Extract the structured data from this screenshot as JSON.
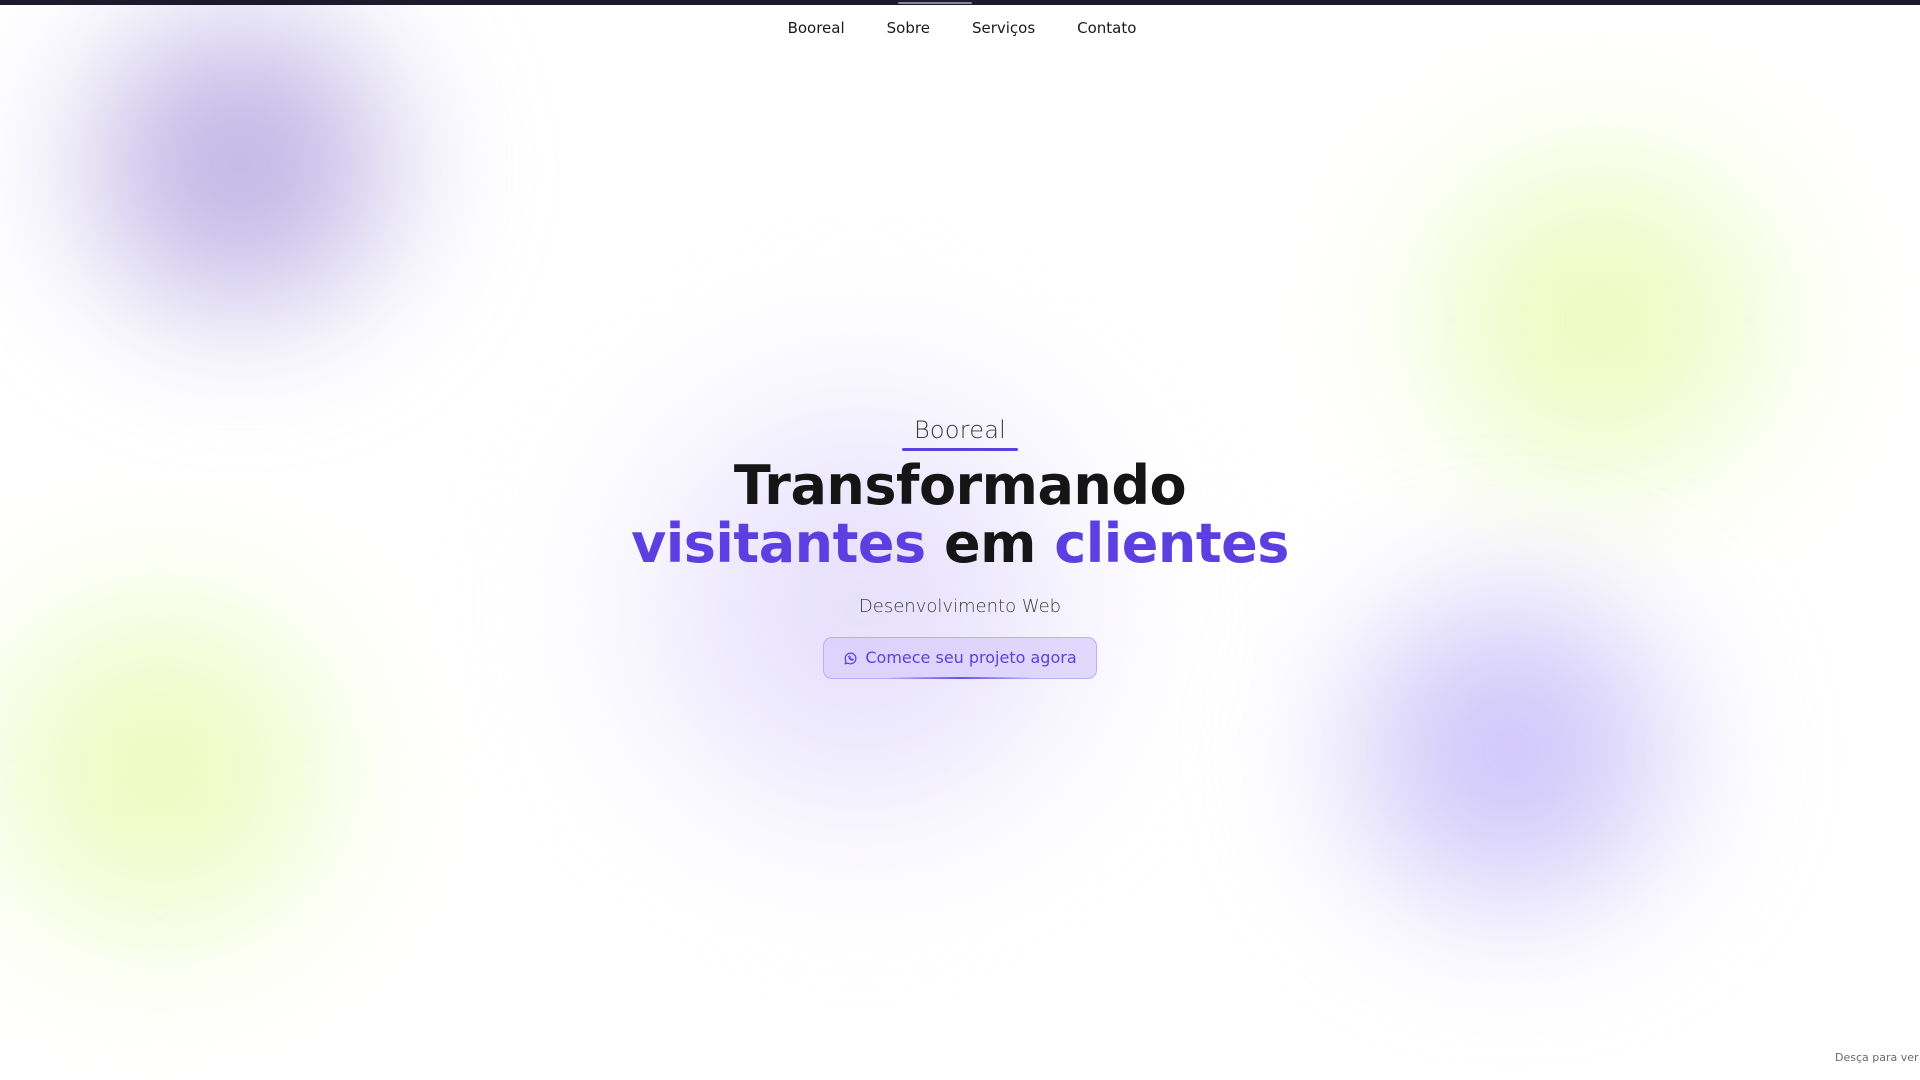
{
  "nav": {
    "items": [
      {
        "label": "Booreal"
      },
      {
        "label": "Sobre"
      },
      {
        "label": "Serviços"
      },
      {
        "label": "Contato"
      }
    ]
  },
  "hero": {
    "brand": "Booreal",
    "headline_line1": "Transformando",
    "headline_word1": "visitantes",
    "headline_word2": "em",
    "headline_word3": "clientes",
    "subtitle": "Desenvolvimento Web",
    "cta_label": "Comece seu projeto agora",
    "cta_icon": "whatsapp-icon"
  },
  "scroll_hint": "Desça para ver m",
  "colors": {
    "accent": "#5b3fe0",
    "text_dark": "#151515",
    "top_bar": "#1d1a2e",
    "blob_purple": "#a898e0",
    "blob_green": "#eef9c4"
  }
}
